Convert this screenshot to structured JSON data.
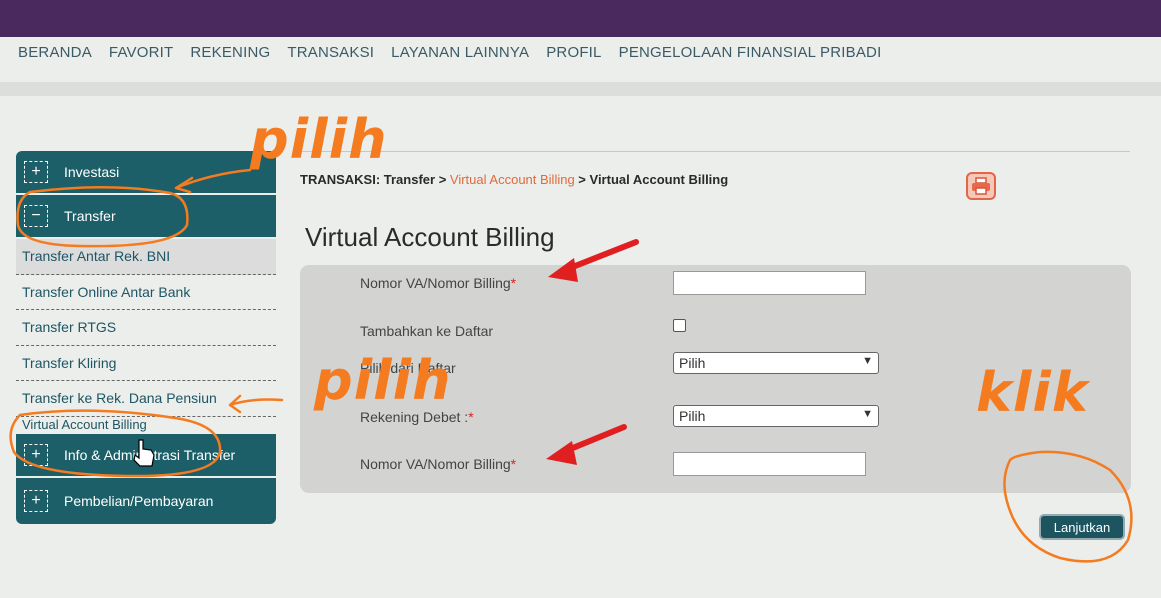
{
  "nav": [
    "BERANDA",
    "FAVORIT",
    "REKENING",
    "TRANSAKSI",
    "LAYANAN LAINNYA",
    "PROFIL",
    "PENGELOLAAN FINANSIAL PRIBADI"
  ],
  "sidebar": {
    "investasi": "Investasi",
    "transfer": "Transfer",
    "items": [
      "Transfer Antar Rek. BNI",
      "Transfer Online Antar Bank",
      "Transfer RTGS",
      "Transfer Kliring",
      "Transfer ke Rek. Dana Pensiun",
      "Virtual Account Billing"
    ],
    "info": "Info & Administrasi Transfer",
    "pembelian": "Pembelian/Pembayaran",
    "plus_icon": "+",
    "minus_icon": "−"
  },
  "breadcrumb": {
    "prefix": "TRANSAKSI: Transfer > ",
    "link": "Virtual Account Billing",
    "suffix": " > Virtual Account Billing"
  },
  "page_title": "Virtual Account Billing",
  "form": {
    "nomor_va_label": "Nomor VA/Nomor Billing",
    "required_mark": "*",
    "tambahkan_label": "Tambahkan ke Daftar",
    "pilih_daftar_label": "Pilih dari Daftar",
    "pilih_daftar_value": "Pilih",
    "rekening_label": "Rekening Debet :",
    "rekening_value": "Pilih",
    "nomor_va2_label": "Nomor VA/Nomor Billing"
  },
  "submit_label": "Lanjutkan",
  "annotations": {
    "pilih1": "pilih",
    "pilih2": "pilih",
    "klik": "klik"
  },
  "colors": {
    "accent": "#1c5f68",
    "header": "#4a2a5e",
    "annotation": "#f47b20",
    "arrow": "#e02020"
  }
}
